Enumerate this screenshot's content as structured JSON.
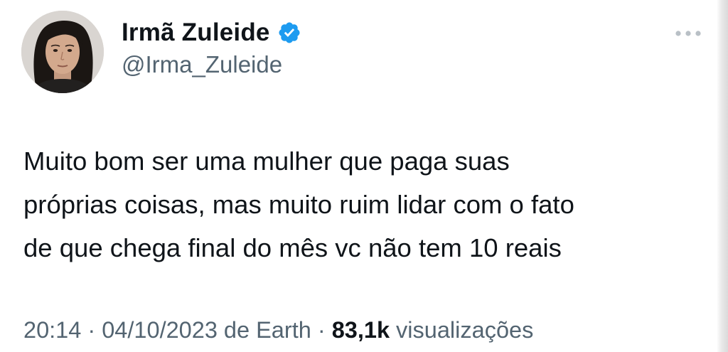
{
  "author": {
    "display_name": "Irmã Zuleide",
    "handle": "@Irma_Zuleide",
    "verified": true,
    "verified_color": "#1d9bf0"
  },
  "more_menu": {
    "icon": "more-horizontal-icon"
  },
  "tweet": {
    "text_lines": [
      "Muito bom ser uma mulher que paga suas",
      "próprias coisas, mas muito ruim lidar com o fato",
      "de que chega final do mês vc não tem 10 reais"
    ]
  },
  "meta": {
    "time": "20:14",
    "separator": " · ",
    "date": "04/10/2023",
    "source": " de Earth",
    "views_count": "83,1k",
    "views_label": " visualizações"
  },
  "colors": {
    "text_primary": "#0f1419",
    "text_secondary": "#536471",
    "background": "#ffffff"
  }
}
